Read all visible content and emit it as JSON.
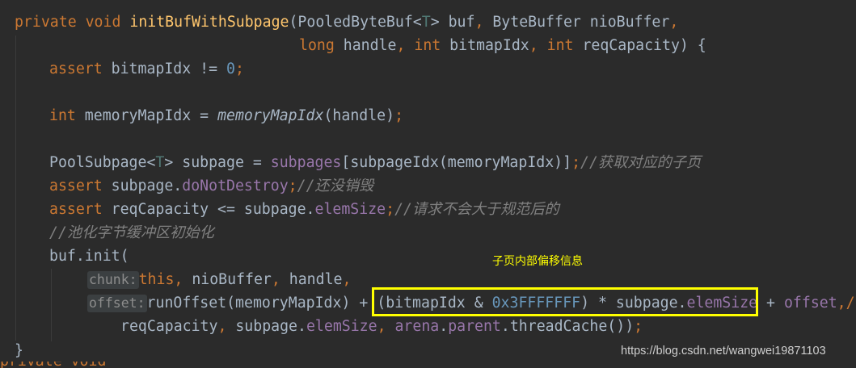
{
  "code": {
    "l1": {
      "t1": "private",
      "t2": " ",
      "t3": "void",
      "t4": " ",
      "t5": "initBufWithSubpage",
      "t6": "(PooledByteBuf<",
      "t7": "T",
      "t8": "> buf",
      "t9": ",",
      "t10": " ByteBuffer nioBuffer",
      "t11": ","
    },
    "l2": {
      "t1": "long",
      "t2": " handle",
      "t3": ",",
      "t4": " ",
      "t5": "int",
      "t6": " bitmapIdx",
      "t7": ",",
      "t8": " ",
      "t9": "int",
      "t10": " reqCapacity) {"
    },
    "l3": {
      "t1": "assert",
      "t2": " bitmapIdx != ",
      "t3": "0",
      "t4": ";"
    },
    "l4": {
      "t1": "int",
      "t2": " memoryMapIdx = ",
      "t3": "memoryMapIdx",
      "t4": "(handle)",
      "t5": ";"
    },
    "l5": {
      "t1": "PoolSubpage<",
      "t2": "T",
      "t3": "> subpage = ",
      "t4": "subpages",
      "t5": "[subpageIdx(memoryMapIdx)]",
      "t6": ";",
      "t7": "//获取对应的子页"
    },
    "l6": {
      "t1": "assert",
      "t2": " subpage.",
      "t3": "doNotDestroy",
      "t4": ";",
      "t5": "//还没销毁"
    },
    "l7": {
      "t1": "assert",
      "t2": " reqCapacity <= subpage.",
      "t3": "elemSize",
      "t4": ";",
      "t5": "//请求不会大于规范后的"
    },
    "l8": {
      "t1": "//池化字节缓冲区初始化"
    },
    "l9": {
      "t1": "buf.init("
    },
    "l10": {
      "hint": "chunk:",
      "t1": "this",
      "t2": ",",
      "t3": " nioBuffer",
      "t4": ",",
      "t5": " handle",
      "t6": ","
    },
    "l11": {
      "hint": "offset:",
      "t1": "runOffset(memoryMapIdx) + (bitmapIdx & ",
      "t2": "0x3FFFFFFF",
      "t3": ") * subpage.",
      "t4": "elemSize",
      "t5": " + ",
      "t6": "offset",
      "t7": ",/"
    },
    "l12": {
      "t1": "reqCapacity",
      "t2": ",",
      "t3": " subpage.",
      "t4": "elemSize",
      "t5": ",",
      "t6": " ",
      "t7": "arena",
      "t8": ".",
      "t9": "parent",
      "t10": ".threadCache())",
      "t11": ";"
    },
    "l13": {
      "t1": "}"
    },
    "l14": {
      "t1": "private void"
    }
  },
  "annotation": "子页内部偏移信息",
  "watermark": "https://blog.csdn.net/wangwei19871103",
  "colors": {
    "background": "#2b2b2b",
    "keyword": "#cc7832",
    "method_declaration": "#ffc66d",
    "number": "#6897bb",
    "field": "#9876aa",
    "type_parameter": "#507874",
    "comment": "#808080",
    "highlight": "#ffff00"
  }
}
